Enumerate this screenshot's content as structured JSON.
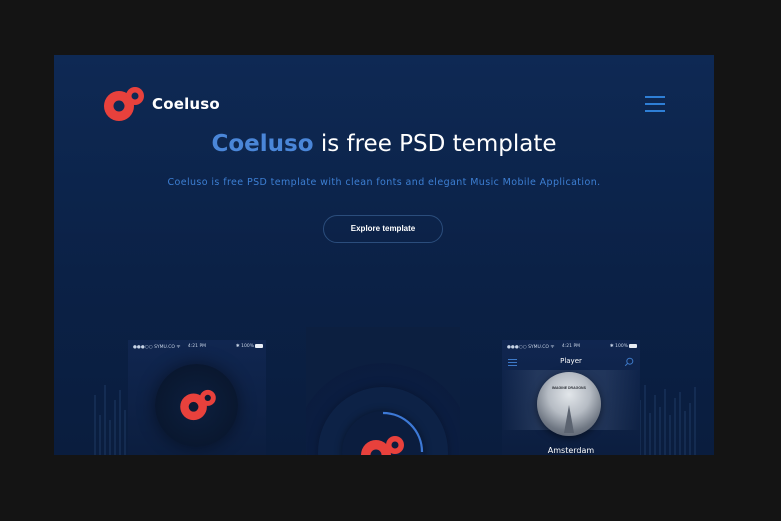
{
  "brand": {
    "name": "Coeluso",
    "logo_color": "#e8413c",
    "accent": "#4a86d8"
  },
  "hero": {
    "title_accent": "Coeluso",
    "title_rest": " is free PSD template",
    "subtitle": "Coeluso is free PSD template with clean fonts and elegant Music Mobile Application.",
    "cta_label": "Explore template"
  },
  "phones": {
    "status_carrier": "●●●○○ SYMU.CO ᯤ",
    "status_time": "4:21 PM",
    "status_battery": "✱ 100%",
    "player_title": "Player",
    "album_text": "IMAGINE DRAGONS",
    "song_title": "Amsterdam"
  },
  "icons": [
    "menu-icon",
    "search-icon",
    "coeluso-logo-icon"
  ]
}
